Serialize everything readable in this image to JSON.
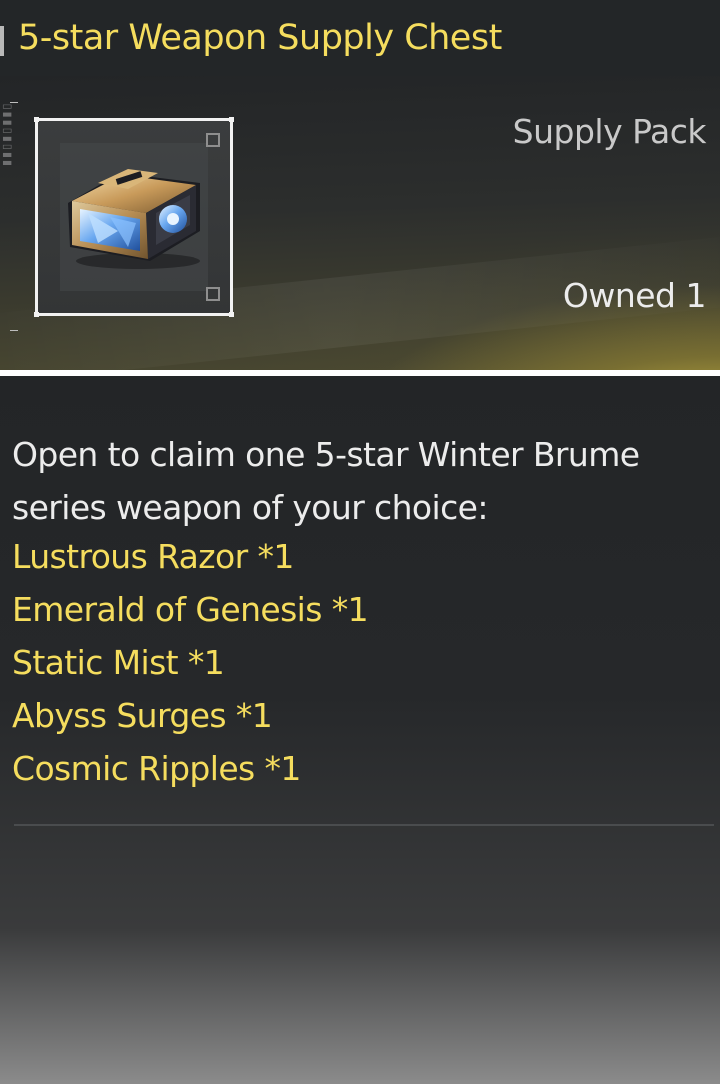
{
  "header": {
    "title": "5-star Weapon Supply Chest"
  },
  "item": {
    "icon": "weapon-supply-chest",
    "type_label": "Supply Pack",
    "owned_label": "Owned 1"
  },
  "description": {
    "text": "Open to claim one 5-star Winter Brume series weapon of your choice:",
    "options": [
      {
        "label": "Lustrous Razor *1"
      },
      {
        "label": "Emerald of Genesis *1"
      },
      {
        "label": "Static Mist *1"
      },
      {
        "label": "Abyss Surges *1"
      },
      {
        "label": "Cosmic Ripples *1"
      }
    ]
  },
  "colors": {
    "accent_yellow": "#f5dd5e",
    "text_light": "#ececec",
    "panel_dark": "#26282a"
  }
}
